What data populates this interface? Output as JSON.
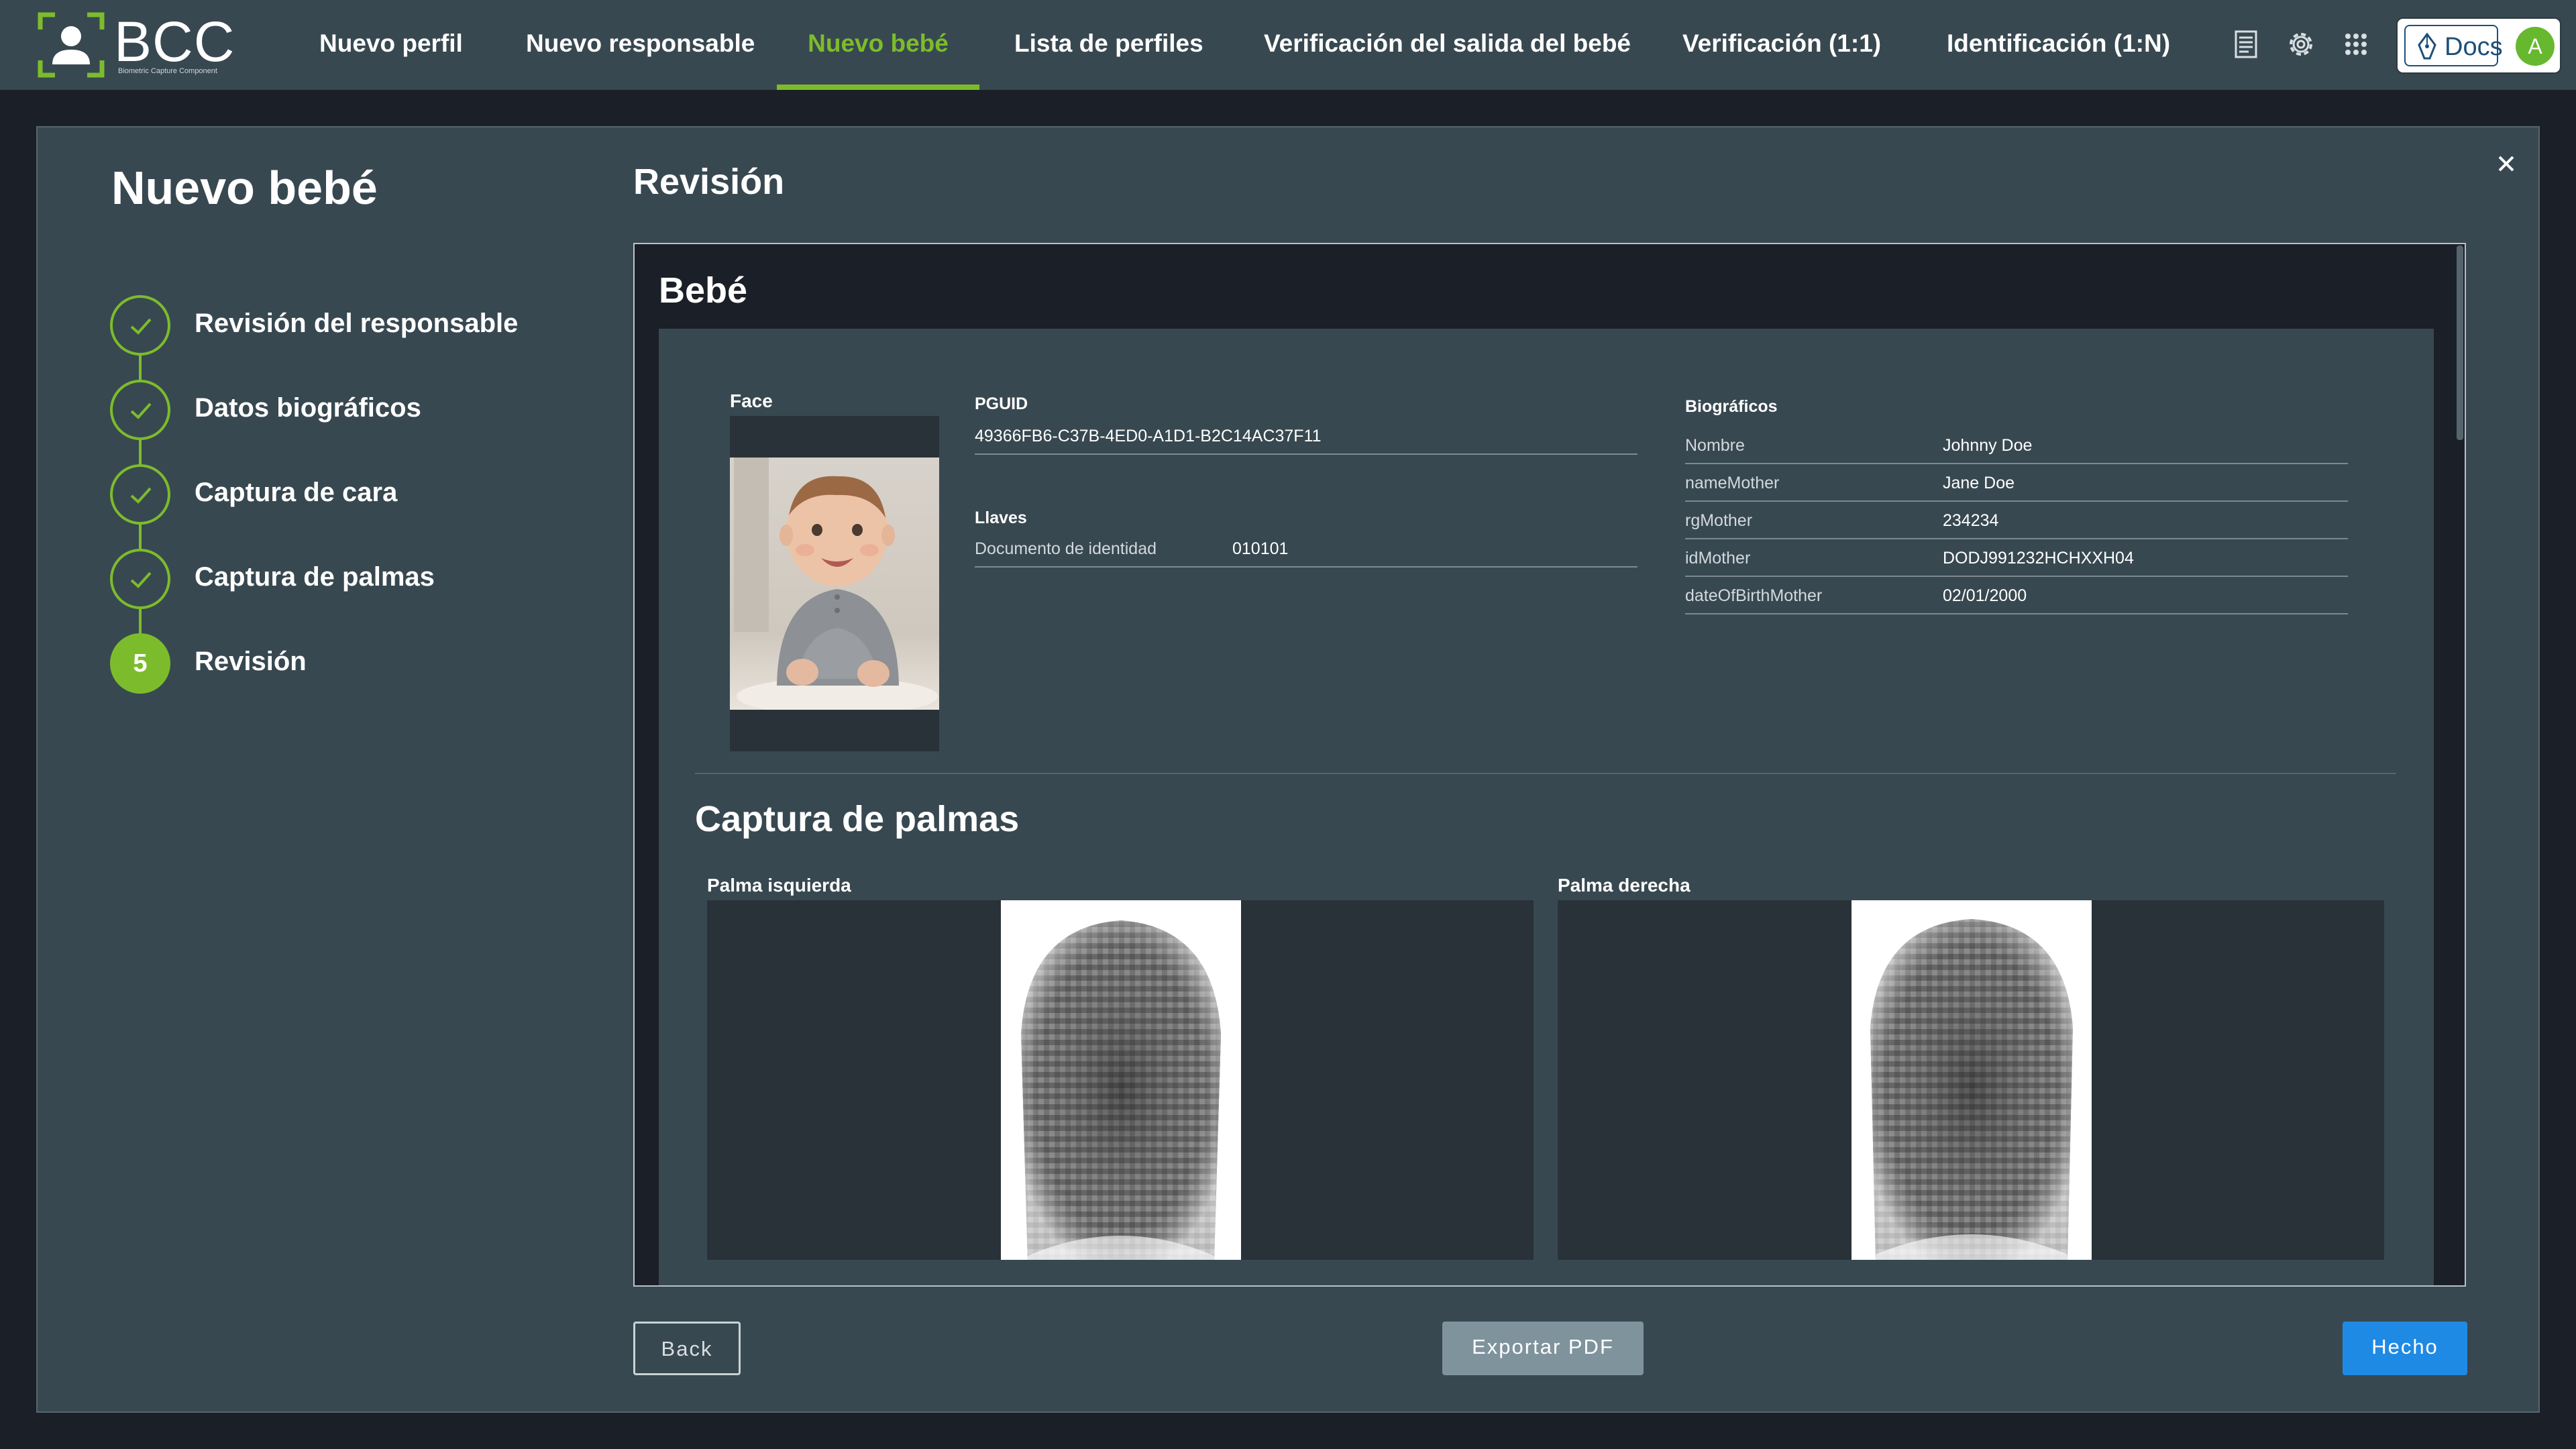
{
  "brand": {
    "name": "BCC",
    "subtitle": "Biometric Capture Component"
  },
  "nav": {
    "items": [
      {
        "label": "Nuevo perfil"
      },
      {
        "label": "Nuevo responsable"
      },
      {
        "label": "Nuevo bebé",
        "active": true
      },
      {
        "label": "Lista de perfiles"
      },
      {
        "label": "Verificación del salida del bebé"
      },
      {
        "label": "Verificación (1:1)"
      },
      {
        "label": "Identificación (1:N)"
      }
    ],
    "docs_label": "Docs",
    "avatar_initial": "A",
    "icons": [
      "document-icon",
      "gear-icon",
      "apps-grid-icon"
    ]
  },
  "wizard": {
    "title": "Nuevo bebé",
    "steps": [
      {
        "label": "Revisión del responsable",
        "status": "done"
      },
      {
        "label": "Datos biográficos",
        "status": "done"
      },
      {
        "label": "Captura de cara",
        "status": "done"
      },
      {
        "label": "Captura de palmas",
        "status": "done"
      },
      {
        "label": "Revisión",
        "status": "current",
        "number": "5"
      }
    ]
  },
  "review": {
    "section_title": "Revisión",
    "card_title": "Bebé",
    "face_label": "Face",
    "pguid_label": "PGUID",
    "pguid_value": "49366FB6-C37B-4ED0-A1D1-B2C14AC37F11",
    "keys_label": "Llaves",
    "keys": [
      {
        "key": "Documento de identidad",
        "value": "010101"
      }
    ],
    "bio_label": "Biográficos",
    "bio": [
      {
        "key": "Nombre",
        "value": "Johnny Doe"
      },
      {
        "key": "nameMother",
        "value": "Jane Doe"
      },
      {
        "key": "rgMother",
        "value": "234234"
      },
      {
        "key": "idMother",
        "value": "DODJ991232HCHXXH04"
      },
      {
        "key": "dateOfBirthMother",
        "value": "02/01/2000"
      }
    ],
    "palms_title": "Captura de palmas",
    "palm_left_label": "Palma isquierda",
    "palm_right_label": "Palma derecha"
  },
  "footer": {
    "back_label": "Back",
    "export_label": "Exportar PDF",
    "done_label": "Hecho"
  },
  "colors": {
    "accent": "#7cbc2c",
    "topbar": "#384850",
    "background": "#1b1f27",
    "primary_button": "#1f8ae4"
  }
}
